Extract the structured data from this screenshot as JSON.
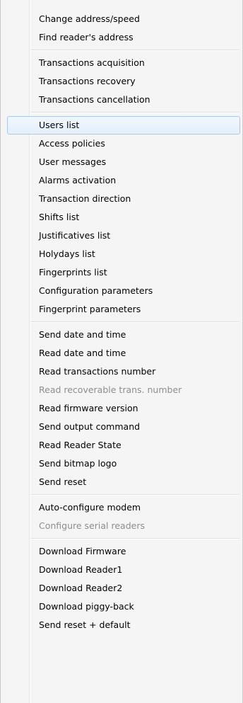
{
  "menu": {
    "groups": [
      {
        "items": [
          {
            "label": "Change address/speed"
          },
          {
            "label": "Find reader's address"
          }
        ]
      },
      {
        "items": [
          {
            "label": "Transactions acquisition"
          },
          {
            "label": "Transactions recovery"
          },
          {
            "label": "Transactions cancellation"
          }
        ]
      },
      {
        "items": [
          {
            "label": "Users list",
            "highlighted": true
          },
          {
            "label": "Access policies"
          },
          {
            "label": "User messages"
          },
          {
            "label": "Alarms activation"
          },
          {
            "label": "Transaction direction"
          },
          {
            "label": "Shifts list"
          },
          {
            "label": "Justificatives list"
          },
          {
            "label": "Holydays list"
          },
          {
            "label": "Fingerprints list"
          },
          {
            "label": "Configuration parameters"
          },
          {
            "label": "Fingerprint parameters"
          }
        ]
      },
      {
        "items": [
          {
            "label": "Send date and time"
          },
          {
            "label": "Read date and time"
          },
          {
            "label": "Read transactions number"
          },
          {
            "label": "Read recoverable trans. number",
            "disabled": true
          },
          {
            "label": "Read firmware version"
          },
          {
            "label": "Send output command"
          },
          {
            "label": "Read Reader State"
          },
          {
            "label": "Send bitmap logo"
          },
          {
            "label": "Send reset"
          }
        ]
      },
      {
        "items": [
          {
            "label": "Auto-configure modem"
          },
          {
            "label": "Configure serial readers",
            "disabled": true
          }
        ]
      },
      {
        "items": [
          {
            "label": "Download Firmware"
          },
          {
            "label": "Download Reader1"
          },
          {
            "label": "Download Reader2"
          },
          {
            "label": "Download piggy-back"
          },
          {
            "label": "Send reset + default"
          }
        ]
      }
    ]
  }
}
